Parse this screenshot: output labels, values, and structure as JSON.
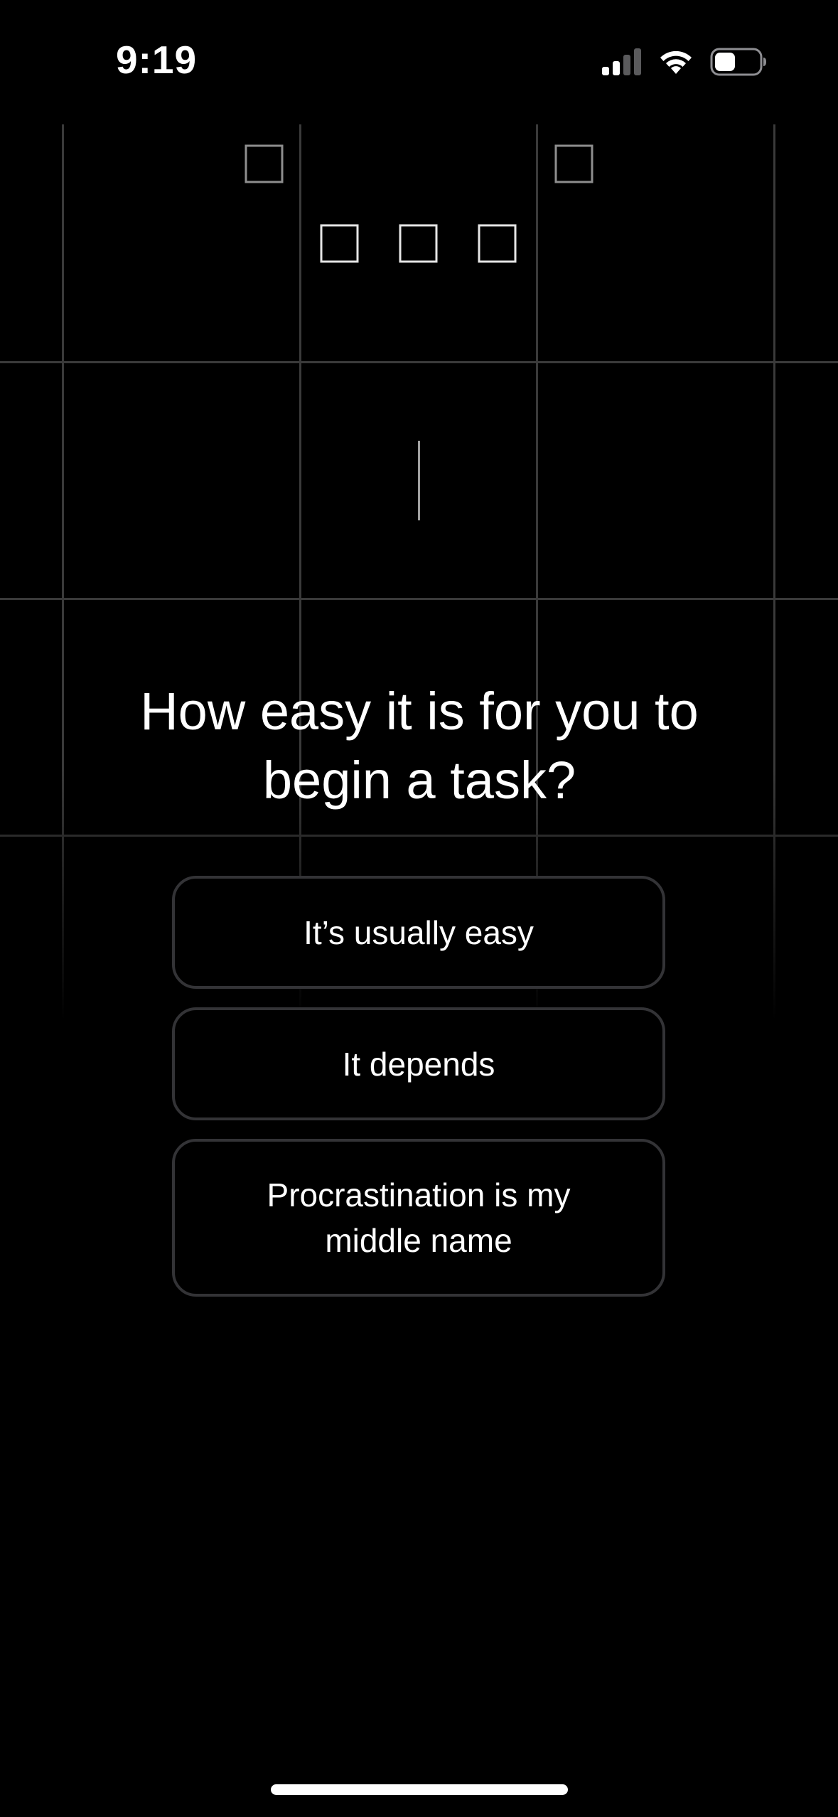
{
  "status_bar": {
    "time": "9:19",
    "icons": [
      "cellular-signal-icon",
      "wifi-icon",
      "battery-icon"
    ]
  },
  "question": {
    "text": "How easy it is for you to begin a task?"
  },
  "options": [
    {
      "label": "It’s usually easy"
    },
    {
      "label": "It depends"
    },
    {
      "label": "Procrastination is my middle name"
    }
  ],
  "colors": {
    "background": "#000000",
    "text": "#ffffff",
    "option_border": "#333336",
    "grid_line": "#3a3a3a"
  }
}
